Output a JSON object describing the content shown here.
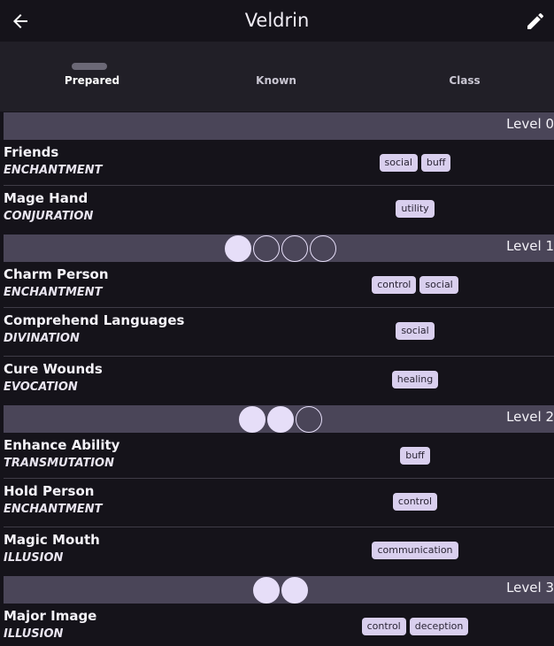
{
  "header": {
    "title": "Veldrin",
    "back_icon": "arrow-left-icon",
    "edit_icon": "pencil-icon"
  },
  "tabs": [
    {
      "label": "Prepared",
      "active": true
    },
    {
      "label": "Known",
      "active": false
    },
    {
      "label": "Class",
      "active": false
    }
  ],
  "levels": [
    {
      "label": "Level 0",
      "slots": [],
      "spells": [
        {
          "name": "Friends",
          "school": "ENCHANTMENT",
          "tags": [
            "social",
            "buff"
          ]
        },
        {
          "name": "Mage Hand",
          "school": "CONJURATION",
          "tags": [
            "utility"
          ]
        }
      ]
    },
    {
      "label": "Level 1",
      "slots": [
        true,
        false,
        false,
        false
      ],
      "spells": [
        {
          "name": "Charm Person",
          "school": "ENCHANTMENT",
          "tags": [
            "control",
            "social"
          ]
        },
        {
          "name": "Comprehend Languages",
          "school": "DIVINATION",
          "tags": [
            "social"
          ]
        },
        {
          "name": "Cure Wounds",
          "school": "EVOCATION",
          "tags": [
            "healing"
          ]
        }
      ]
    },
    {
      "label": "Level 2",
      "slots": [
        true,
        true,
        false
      ],
      "spells": [
        {
          "name": "Enhance Ability",
          "school": "TRANSMUTATION",
          "tags": [
            "buff"
          ]
        },
        {
          "name": "Hold Person",
          "school": "ENCHANTMENT",
          "tags": [
            "control"
          ]
        },
        {
          "name": "Magic Mouth",
          "school": "ILLUSION",
          "tags": [
            "communication"
          ]
        }
      ]
    },
    {
      "label": "Level 3",
      "slots": [
        true,
        true
      ],
      "spells": [
        {
          "name": "Major Image",
          "school": "ILLUSION",
          "tags": [
            "control",
            "deception"
          ]
        }
      ]
    }
  ],
  "colors": {
    "background": "#15131a",
    "tabbar": "#211f27",
    "level_header": "#4a4558",
    "slot": "#e6def8",
    "tag": "#d9cfee"
  }
}
